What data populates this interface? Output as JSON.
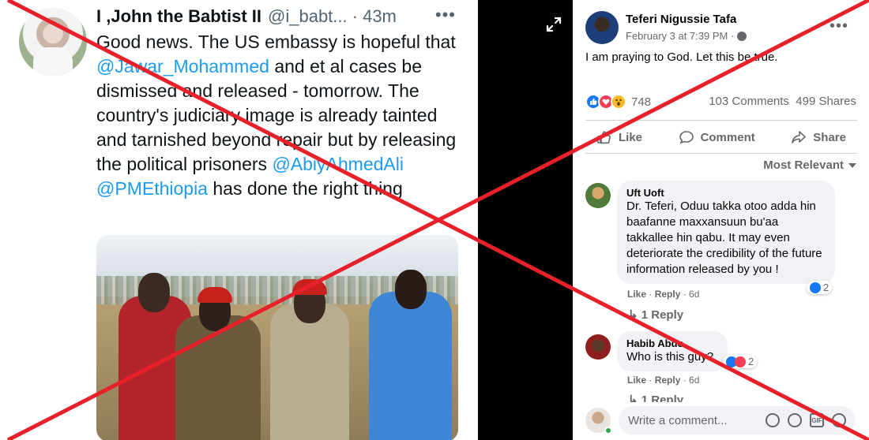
{
  "tweet": {
    "name": "I ,John the Babtist II",
    "handle": "@i_babt...",
    "time": "· 43m",
    "more": "•••",
    "text_1": "Good news. The US embassy is hopeful that ",
    "mention_1": "@Jawar_Mohammed",
    "text_2": " and et al cases be dismissed and released - tomorrow. The country's judiciary image is already tainted and tarnished beyond repair but by releasing the political prisoners ",
    "mention_2": "@AbiyAhmedAli",
    "mention_3": "@PMEthiopia",
    "text_3": " has done the right thing",
    "link_color": "#1d9bf0"
  },
  "post": {
    "author": "Teferi Nigussie Tafa",
    "date": "February 3 at 7:39 PM ·",
    "more": "•••",
    "text": "I am praying to God. Let this be true.",
    "reaction_count": "748",
    "comments_count": "103 Comments",
    "shares_count": "499 Shares",
    "actions": {
      "like": "Like",
      "comment": "Comment",
      "share": "Share"
    },
    "sort_label": "Most Relevant"
  },
  "comments": [
    {
      "name": "Uft Uoft",
      "text": "Dr. Teferi, Oduu takka otoo adda hin baafanne maxxansuun bu'aa takkallee hin qabu. It may even deteriorate the credibility of the future information released by you !",
      "reactions": "2",
      "like": "Like",
      "reply": "Reply",
      "age": "6d",
      "replies": "1 Reply"
    },
    {
      "name": "Habib Abdo",
      "text": "Who is this guy?",
      "reactions": "2",
      "like": "Like",
      "reply": "Reply",
      "age": "6d",
      "replies": "1 Reply"
    }
  ],
  "composer": {
    "placeholder": "Write a comment..."
  },
  "overlay": {
    "cross_color": "#e8202a"
  }
}
